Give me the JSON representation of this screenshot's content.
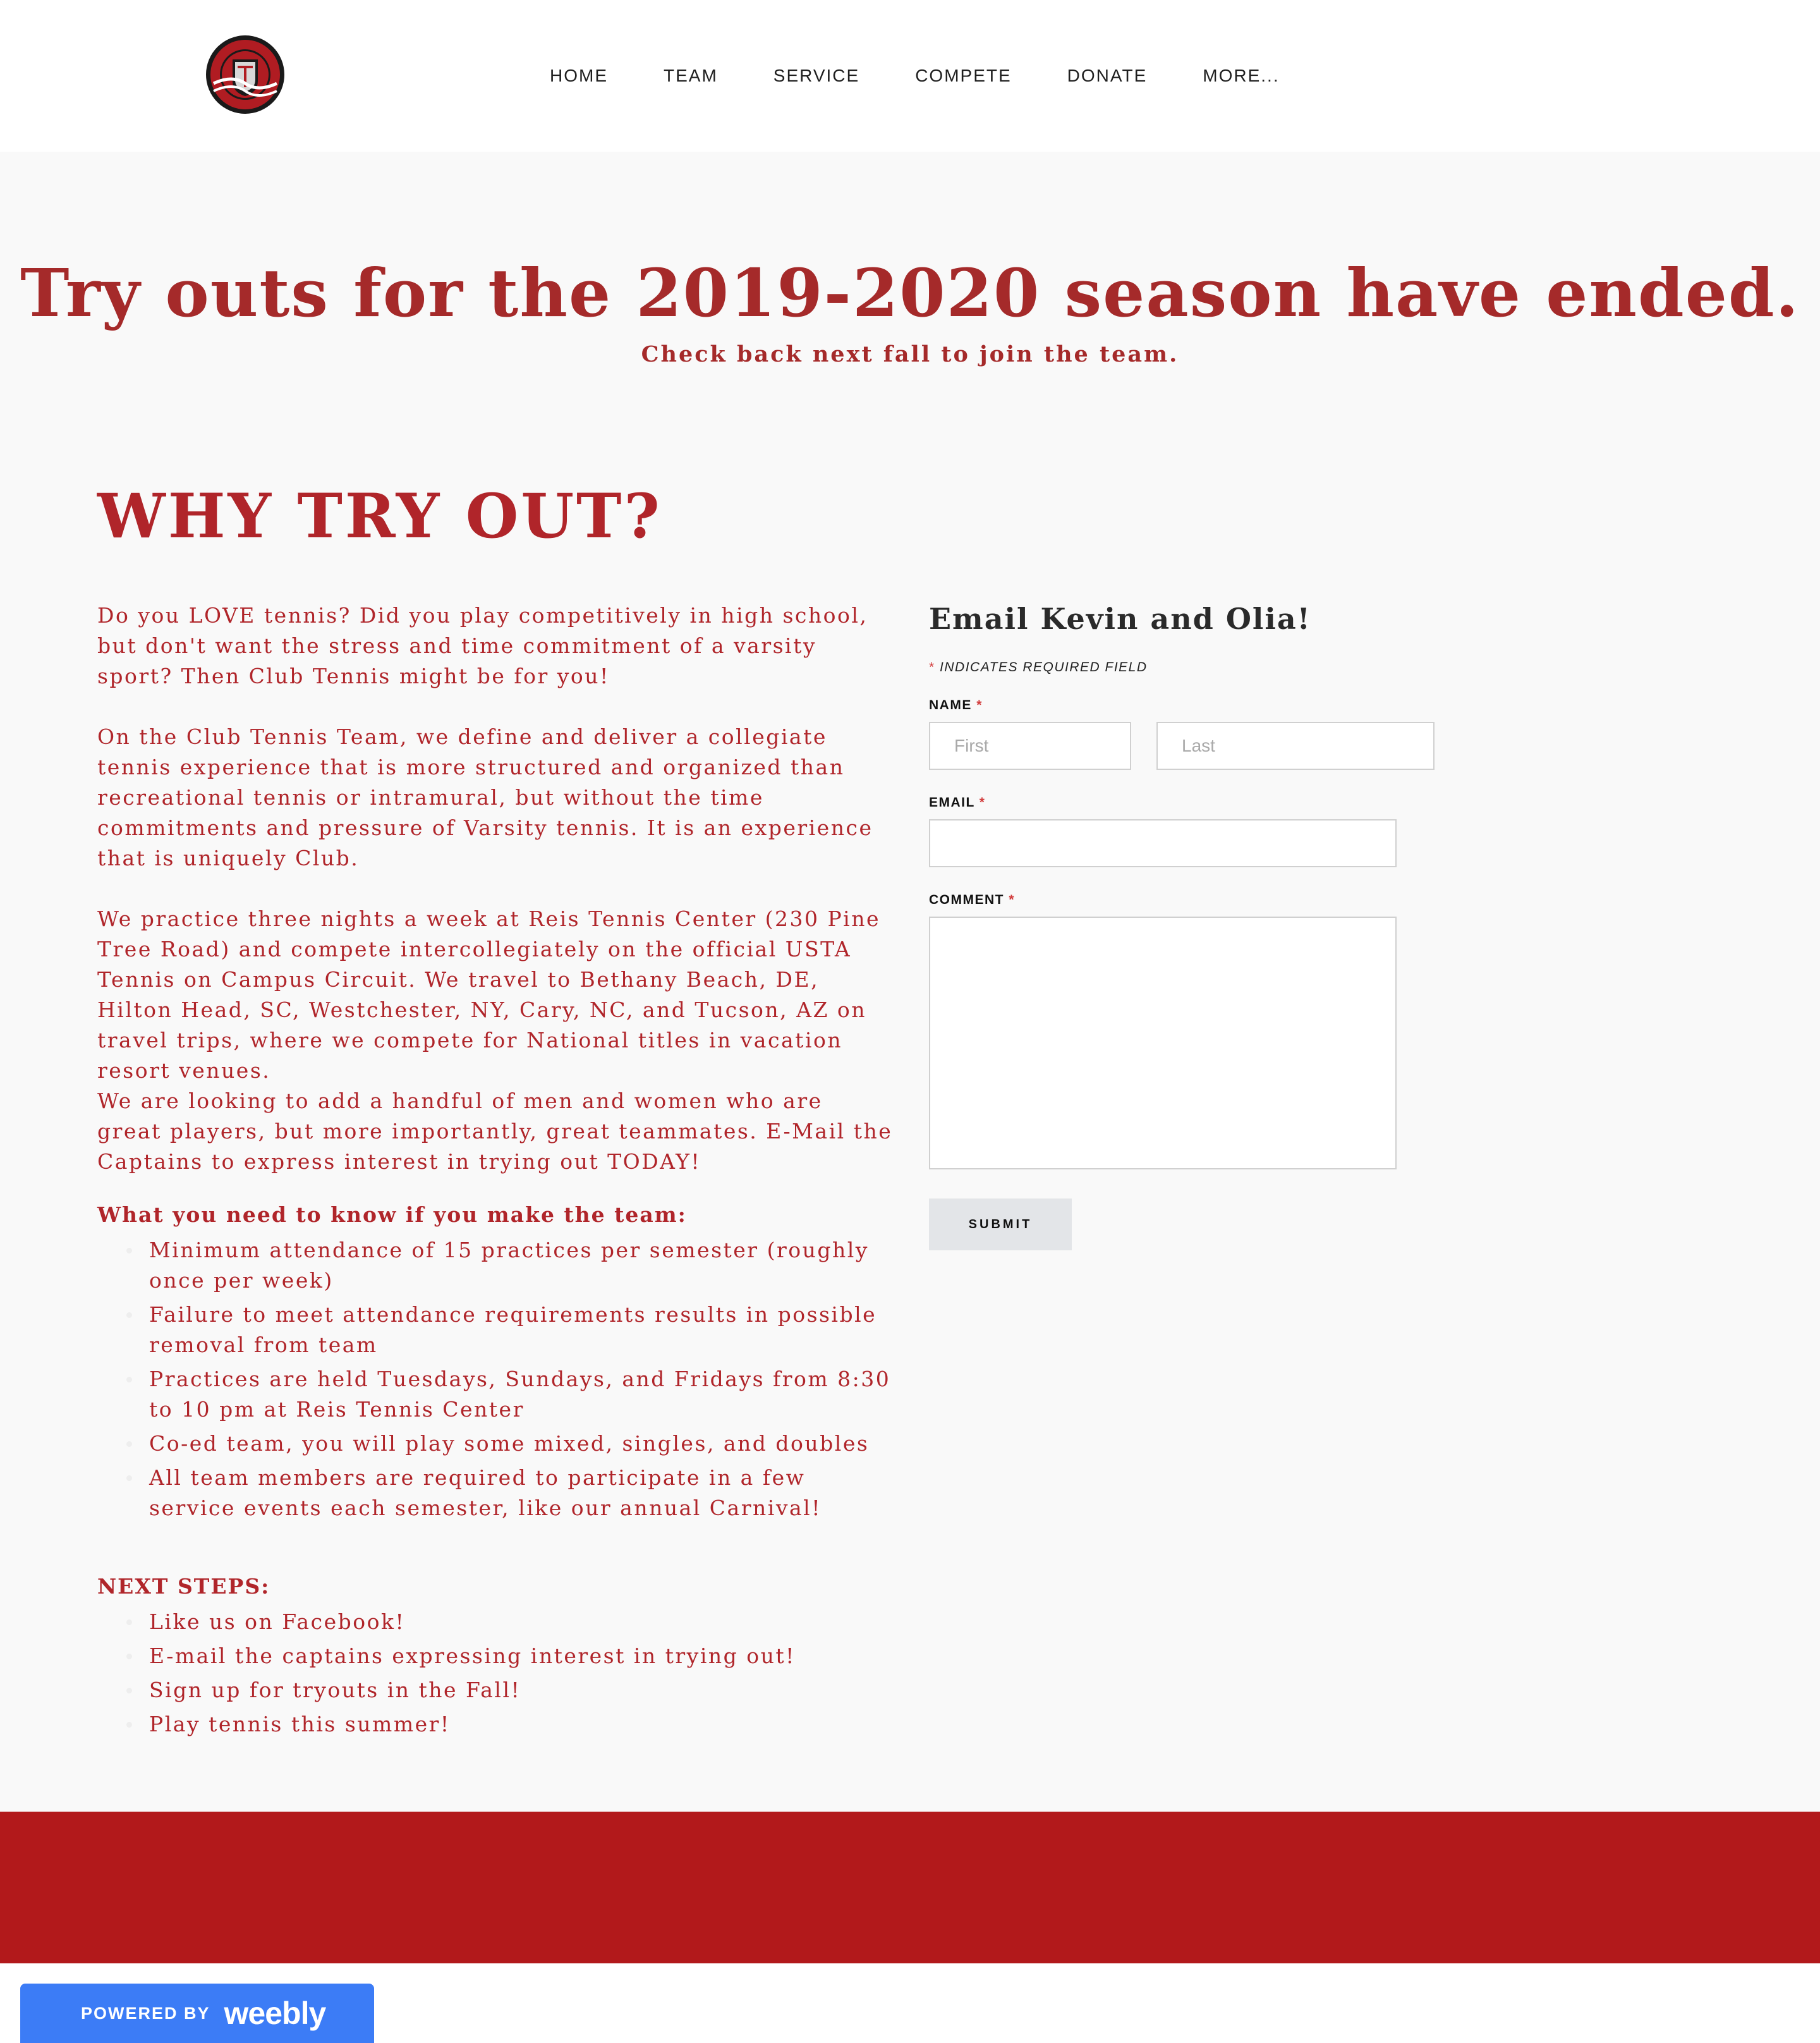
{
  "nav": {
    "items": [
      "HOME",
      "TEAM",
      "SERVICE",
      "COMPETE",
      "DONATE",
      "MORE..."
    ]
  },
  "banner": {
    "title": "Try outs for the 2019-2020 season have ended.",
    "subtitle": "Check back next fall to join the team."
  },
  "why": {
    "title": "WHY TRY OUT?",
    "paragraphs": [
      "Do you LOVE tennis? Did you play competitively in high school, but don't want the stress and time commitment of a varsity sport? Then Club Tennis might be for you!",
      "On the Club Tennis Team, we define and deliver a collegiate tennis experience that is more structured and organized than recreational tennis or intramural, but without the time commitments and pressure of Varsity tennis. It is an experience that is uniquely Club.",
      "We practice three nights a week at Reis Tennis Center (230 Pine Tree Road) and compete intercollegiately on the official USTA Tennis on Campus Circuit. We travel to Bethany Beach, DE, Hilton Head, SC, Westchester, NY, Cary, NC, and Tucson, AZ on travel trips, where we compete for National titles in vacation resort venues.",
      "We are looking to add a handful of men and women who are great players, but more importantly, great teammates. E-Mail the Captains to express interest in trying out TODAY!"
    ],
    "need_to_know": {
      "heading": "What you need to know if you make the team:",
      "items": [
        "Minimum attendance of 15 practices per semester (roughly once per week)",
        "Failure to meet attendance requirements results in possible removal from team",
        "Practices are held Tuesdays, Sundays, and Fridays from 8:30 to 10 pm at Reis Tennis Center",
        "Co-ed team, you will play some mixed, singles, and doubles",
        "All team members are required to participate in a few service events each semester, like our annual Carnival!"
      ]
    },
    "next_steps": {
      "heading": "NEXT STEPS:",
      "items": [
        "Like us on Facebook!",
        "E-mail the captains expressing interest in trying out!",
        "Sign up for tryouts in the Fall!",
        "Play tennis this summer!"
      ]
    }
  },
  "form": {
    "title": "Email Kevin and Olia!",
    "required_star": "*",
    "required_note": "INDICATES REQUIRED FIELD",
    "name_label": "NAME",
    "first_placeholder": "First",
    "last_placeholder": "Last",
    "email_label": "EMAIL",
    "comment_label": "COMMENT",
    "submit_label": "SUBMIT"
  },
  "footer": {
    "badge_small": "POWERED BY",
    "badge_brand": "weebly"
  },
  "colors": {
    "accent": "#b0252a",
    "footer_band": "#b2191b",
    "badge": "#3c7cf6",
    "page_bg": "#f9f9f9"
  },
  "icons": {
    "logo": "club-tennis-seal-icon"
  }
}
